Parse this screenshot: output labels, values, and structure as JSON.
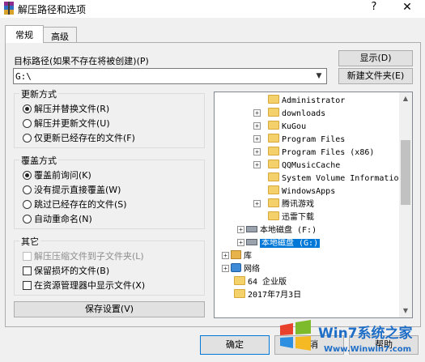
{
  "window": {
    "title": "解压路径和选项",
    "help": "?",
    "close": "✕"
  },
  "tabs": [
    {
      "label": "常规"
    },
    {
      "label": "高级"
    }
  ],
  "path": {
    "label": "目标路径(如果不存在将被创建)(P)",
    "value": "G:\\",
    "show_button": "显示(D)",
    "new_folder_button": "新建文件夹(E)"
  },
  "update_mode": {
    "title": "更新方式",
    "options": [
      {
        "label": "解压并替换文件(R)",
        "selected": true
      },
      {
        "label": "解压并更新文件(U)",
        "selected": false
      },
      {
        "label": "仅更新已经存在的文件(F)",
        "selected": false
      }
    ]
  },
  "overwrite_mode": {
    "title": "覆盖方式",
    "options": [
      {
        "label": "覆盖前询问(K)",
        "selected": true
      },
      {
        "label": "没有提示直接覆盖(W)",
        "selected": false
      },
      {
        "label": "跳过已经存在的文件(S)",
        "selected": false
      },
      {
        "label": "自动重命名(N)",
        "selected": false
      }
    ]
  },
  "misc": {
    "title": "其它",
    "options": [
      {
        "label": "解压压缩文件到子文件夹(L)",
        "checked": false,
        "disabled": true
      },
      {
        "label": "保留损坏的文件(B)",
        "checked": false,
        "disabled": false
      },
      {
        "label": "在资源管理器中显示文件(X)",
        "checked": false,
        "disabled": false
      }
    ]
  },
  "save_button": "保存设置(V)",
  "tree": {
    "items": [
      {
        "label": "Administrator",
        "type": "folder",
        "expander": ""
      },
      {
        "label": "downloads",
        "type": "folder",
        "expander": "+"
      },
      {
        "label": "KuGou",
        "type": "folder",
        "expander": "+"
      },
      {
        "label": "Program Files",
        "type": "folder",
        "expander": "+"
      },
      {
        "label": "Program Files (x86)",
        "type": "folder",
        "expander": "+"
      },
      {
        "label": "QQMusicCache",
        "type": "folder",
        "expander": "+"
      },
      {
        "label": "System Volume Informatio",
        "type": "folder",
        "expander": ""
      },
      {
        "label": "WindowsApps",
        "type": "folder",
        "expander": ""
      },
      {
        "label": "腾讯游戏",
        "type": "folder",
        "expander": "+"
      },
      {
        "label": "迅雷下载",
        "type": "folder",
        "expander": ""
      },
      {
        "label": "本地磁盘 (F:)",
        "type": "drive",
        "expander": "+"
      },
      {
        "label": "本地磁盘 (G:)",
        "type": "drive",
        "expander": "+",
        "selected": true
      },
      {
        "label": "库",
        "type": "library",
        "expander": "+"
      },
      {
        "label": "网络",
        "type": "network",
        "expander": "+"
      },
      {
        "label": "64 企业版",
        "type": "folder",
        "expander": ""
      },
      {
        "label": "2017年7月3日",
        "type": "folder",
        "expander": ""
      }
    ]
  },
  "footer": {
    "ok": "确定",
    "cancel": "取消",
    "help": "帮助"
  },
  "watermark": {
    "brand": "Win7系统之家",
    "url": "Www.Winwin7.com"
  }
}
